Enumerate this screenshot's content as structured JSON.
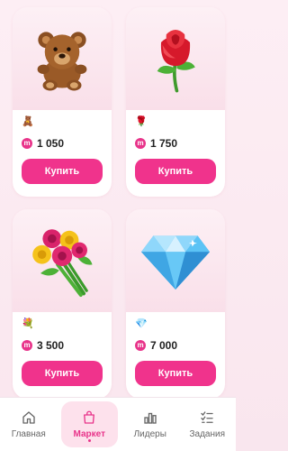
{
  "cards": [
    {
      "emoji": "🧸",
      "price": "1 050",
      "buy_label": "Купить",
      "icon": "teddy-bear-icon"
    },
    {
      "emoji": "🌹",
      "price": "1 750",
      "buy_label": "Купить",
      "icon": "rose-icon"
    },
    {
      "emoji": "💐",
      "price": "3 500",
      "buy_label": "Купить",
      "icon": "bouquet-icon"
    },
    {
      "emoji": "💎",
      "price": "7 000",
      "buy_label": "Купить",
      "icon": "diamond-icon"
    }
  ],
  "coin_letter": "m",
  "tabs": [
    {
      "label": "Главная",
      "icon": "home-icon"
    },
    {
      "label": "Маркет",
      "icon": "shopping-bag-icon",
      "active": true
    },
    {
      "label": "Лидеры",
      "icon": "bar-chart-icon"
    },
    {
      "label": "Задания",
      "icon": "checklist-icon"
    }
  ],
  "colors": {
    "accent": "#f0338c",
    "coin": "#e8348a",
    "card_bg": "#fbe7ef"
  }
}
